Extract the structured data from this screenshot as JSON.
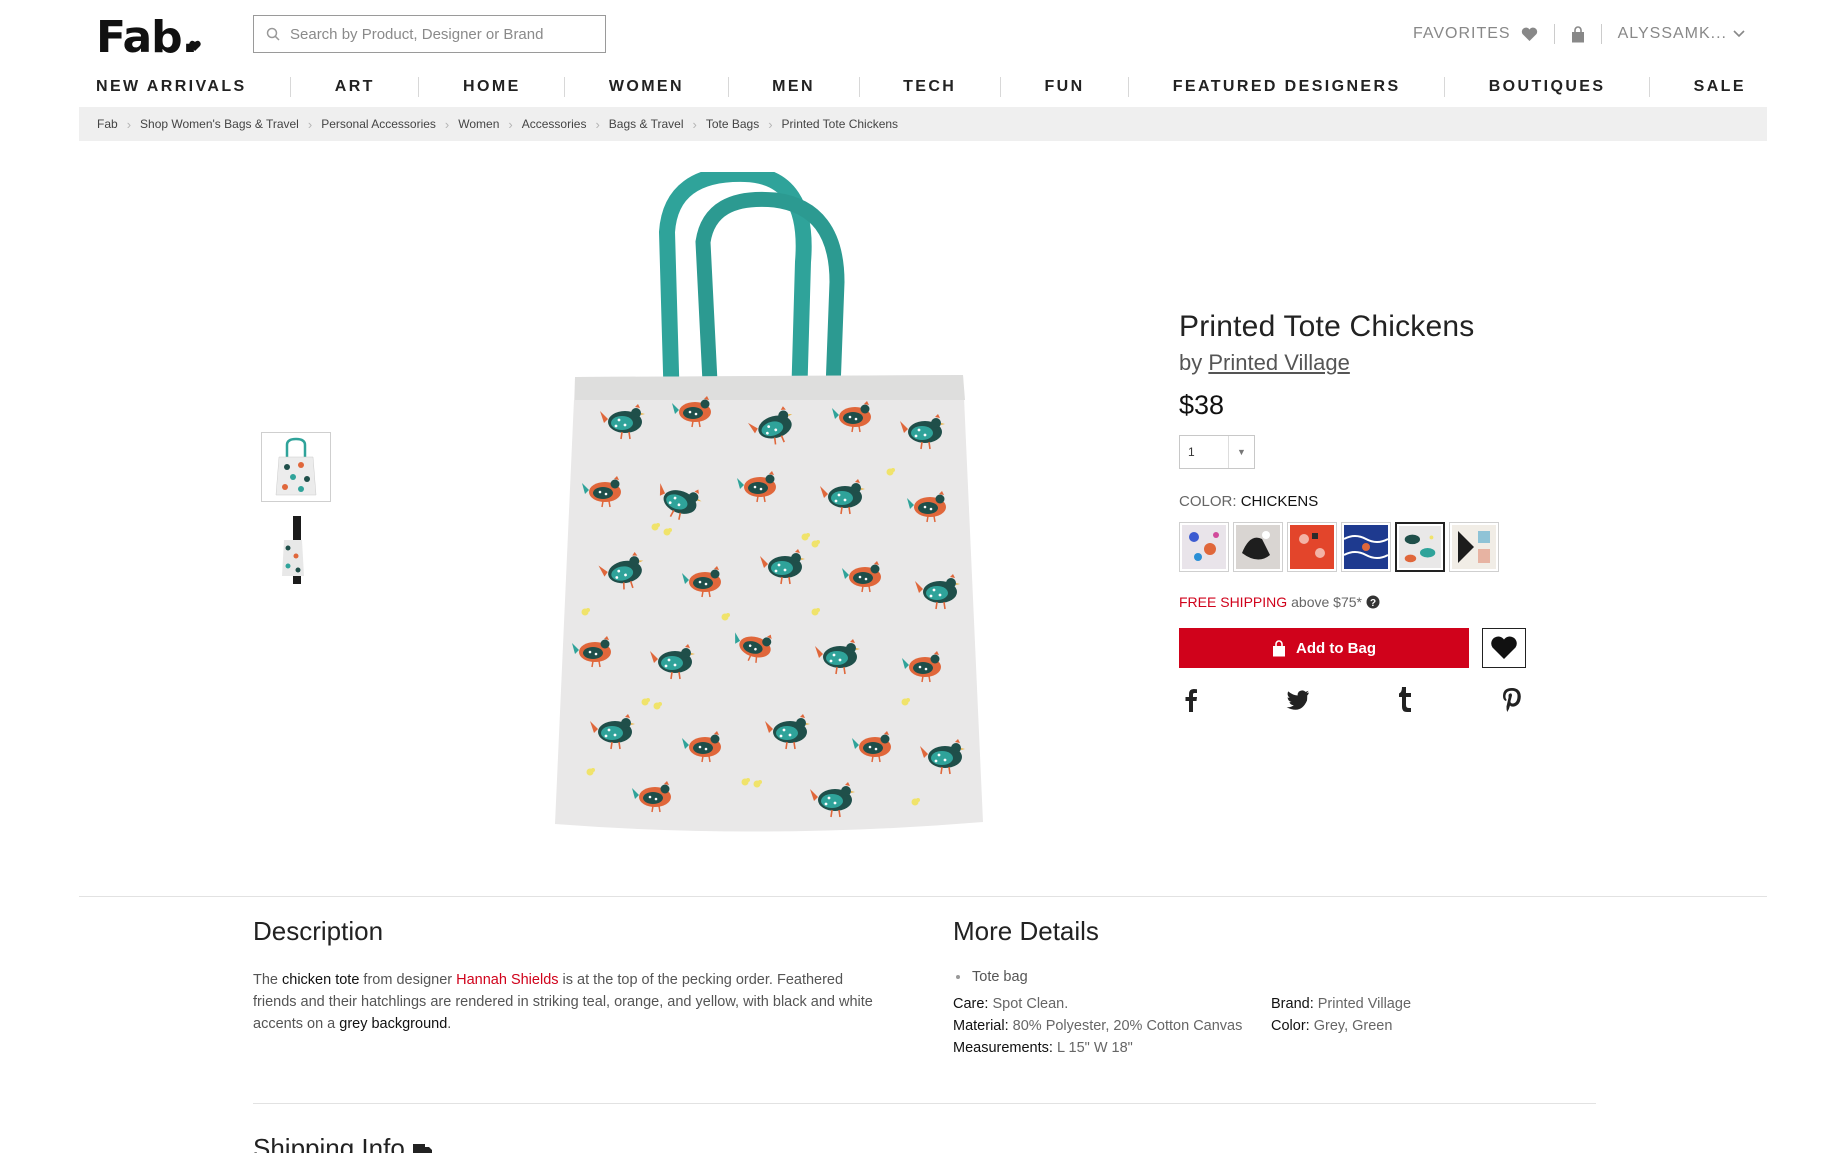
{
  "header": {
    "logo": "Fab",
    "search_placeholder": "Search by Product, Designer or Brand",
    "favorites_label": "FAVORITES",
    "user_label": "ALYSSAMK..."
  },
  "nav": [
    "NEW ARRIVALS",
    "ART",
    "HOME",
    "WOMEN",
    "MEN",
    "TECH",
    "FUN",
    "FEATURED DESIGNERS",
    "BOUTIQUES",
    "SALE"
  ],
  "breadcrumb": [
    "Fab",
    "Shop Women's Bags & Travel",
    "Personal Accessories",
    "Women",
    "Accessories",
    "Bags & Travel",
    "Tote Bags",
    "Printed Tote Chickens"
  ],
  "product": {
    "title": "Printed Tote Chickens",
    "by_prefix": "by",
    "brand": "Printed Village",
    "price": "$38",
    "quantity": "1",
    "color_label": "COLOR:",
    "color_value": "CHICKENS",
    "swatch_count": 6,
    "selected_swatch": 5,
    "shipping_free": "FREE SHIPPING",
    "shipping_rest": "above $75*",
    "add_to_bag": "Add to Bag"
  },
  "colors": {
    "accent_red": "#d0021b",
    "breadcrumb_bg": "#efefef"
  },
  "description": {
    "heading": "Description",
    "p1": "The ",
    "b1": "chicken tote",
    "p2": " from designer ",
    "designer": "Hannah Shields",
    "p3": " is at the top of the pecking order. Feathered friends and their hatchlings are rendered in striking teal, orange, and yellow, with black and white accents on a ",
    "b2": "grey background",
    "p4": "."
  },
  "details": {
    "heading": "More Details",
    "bullet": "Tote bag",
    "care_k": "Care:",
    "care_v": "Spot Clean.",
    "material_k": "Material:",
    "material_v": "80% Polyester, 20% Cotton Canvas",
    "measure_k": "Measurements:",
    "measure_v": "L 15\" W 18\"",
    "brand_k": "Brand:",
    "brand_v": "Printed Village",
    "color_k": "Color:",
    "color_v": "Grey, Green"
  },
  "shipping_heading": "Shipping Info"
}
